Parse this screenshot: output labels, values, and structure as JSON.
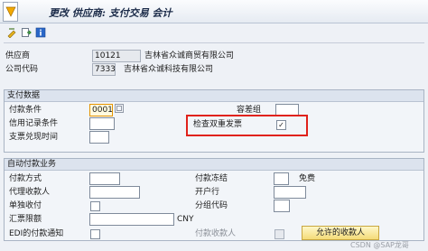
{
  "title": "更改 供应商: 支付交易 会计",
  "header": {
    "vendor_label": "供应商",
    "vendor_value": "10121",
    "vendor_name": "吉林省众诚商贸有限公司",
    "company_label": "公司代码",
    "company_value": "7333",
    "company_name": "吉林省众诚科技有限公司"
  },
  "payment_data": {
    "section_title": "支付数据",
    "terms_label": "付款条件",
    "terms_value": "0001",
    "credit_memo_label": "信用记录条件",
    "check_cashing_label": "支票兑现时间",
    "tolerance_label": "容差组",
    "double_invoice_label": "检查双重发票",
    "double_invoice_checked": "✓"
  },
  "auto_payment": {
    "section_title": "自动付款业务",
    "method_label": "付款方式",
    "alt_payee_label": "代理收款人",
    "individual_pmnt_label": "单独收付",
    "bill_of_exch_label": "汇票限额",
    "currency": "CNY",
    "edi_label": "EDI的付款通知",
    "block_label": "付款冻结",
    "block_text": "免费",
    "house_bank_label": "开户行",
    "grouping_label": "分组代码",
    "payee_in_doc_label": "付款收款人",
    "allowed_payee_button": "允许的收款人"
  },
  "watermark": "CSDN @SAP龙哥"
}
